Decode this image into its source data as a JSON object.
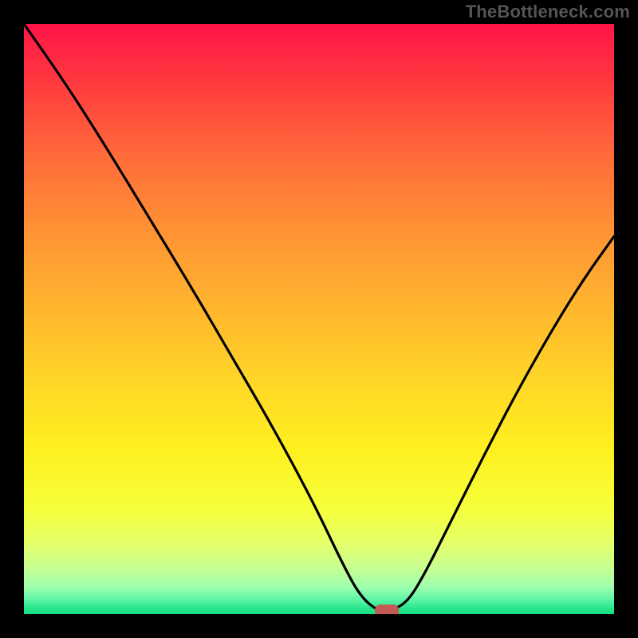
{
  "watermark": "TheBottleneck.com",
  "colors": {
    "page_bg": "#000000",
    "curve_stroke": "#000000",
    "marker_fill": "#c25a55"
  },
  "chart_data": {
    "type": "line",
    "title": "",
    "xlabel": "",
    "ylabel": "",
    "xlim": [
      0,
      100
    ],
    "ylim": [
      0,
      100
    ],
    "x": [
      0,
      7,
      14,
      21,
      28,
      35,
      42,
      49,
      54,
      57,
      60,
      62,
      65,
      68,
      72,
      78,
      84,
      90,
      95,
      100
    ],
    "values": [
      100,
      90,
      79,
      67.5,
      56,
      44,
      32,
      19,
      8.5,
      3,
      0.5,
      0.5,
      2,
      7,
      15,
      27,
      38.5,
      49,
      57,
      64
    ],
    "optimum_x": 61.5,
    "gradient_stops": [
      {
        "offset": 0.0,
        "color": "#ff1447"
      },
      {
        "offset": 0.1,
        "color": "#ff3a3f"
      },
      {
        "offset": 0.22,
        "color": "#ff6a3a"
      },
      {
        "offset": 0.35,
        "color": "#ff9234"
      },
      {
        "offset": 0.48,
        "color": "#ffb52e"
      },
      {
        "offset": 0.6,
        "color": "#ffd527"
      },
      {
        "offset": 0.72,
        "color": "#fff020"
      },
      {
        "offset": 0.82,
        "color": "#f6ff3a"
      },
      {
        "offset": 0.88,
        "color": "#e4ff6a"
      },
      {
        "offset": 0.92,
        "color": "#c8ff90"
      },
      {
        "offset": 0.955,
        "color": "#9effae"
      },
      {
        "offset": 0.975,
        "color": "#5ef5a6"
      },
      {
        "offset": 0.99,
        "color": "#29e78f"
      },
      {
        "offset": 1.0,
        "color": "#14df82"
      }
    ]
  }
}
